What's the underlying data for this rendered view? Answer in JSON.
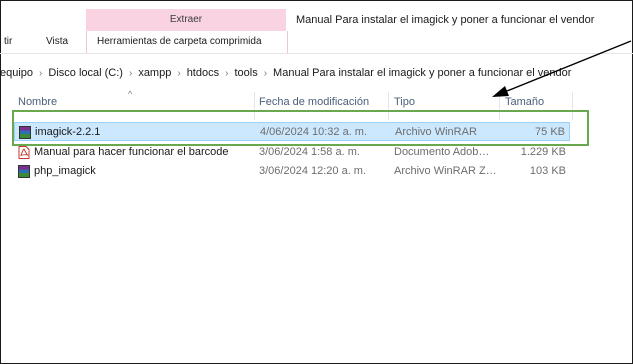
{
  "ribbon": {
    "tab_partial_left": "tir",
    "tab_view": "Vista",
    "context_group": "Extraer",
    "context_tab": "Herramientas de carpeta comprimida",
    "window_title": "Manual Para instalar el imagick y poner a funcionar el vendor"
  },
  "address": {
    "crumbs": [
      "equipo",
      "Disco local (C:)",
      "xampp",
      "htdocs",
      "tools",
      "Manual Para instalar el imagick y poner a funcionar el vendor"
    ],
    "separator": "›"
  },
  "columns": {
    "name": "Nombre",
    "date": "Fecha de modificación",
    "type": "Tipo",
    "size": "Tamaño",
    "sort_indicator": "^"
  },
  "files": [
    {
      "name": "imagick-2.2.1",
      "date": "4/06/2024 10:32 a. m.",
      "type": "Archivo WinRAR",
      "size": "75 KB",
      "icon": "winrar-archive-icon",
      "selected": true
    },
    {
      "name": "Manual para hacer funcionar el barcode",
      "date": "3/06/2024 1:58 a. m.",
      "type": "Documento Adob…",
      "size": "1.229 KB",
      "icon": "pdf-document-icon",
      "selected": false
    },
    {
      "name": "php_imagick",
      "date": "3/06/2024 12:20 a. m.",
      "type": "Archivo WinRAR Z…",
      "size": "103 KB",
      "icon": "winrar-zip-icon",
      "selected": false
    }
  ],
  "colors": {
    "selection": "#cce8ff",
    "context_tab": "#f9d3e2",
    "highlight_box": "#6aa84f"
  }
}
